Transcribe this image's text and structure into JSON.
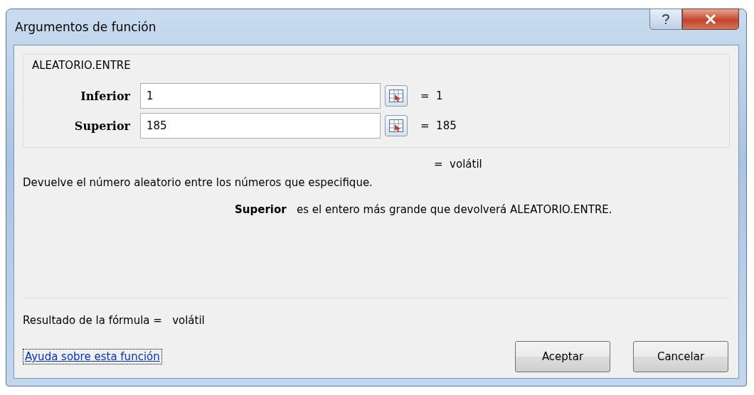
{
  "window": {
    "title": "Argumentos de función"
  },
  "function_name": "ALEATORIO.ENTRE",
  "arguments": [
    {
      "label": "Inferior",
      "value": "1",
      "result": "=  1"
    },
    {
      "label": "Superior",
      "value": "185",
      "result": "=  185"
    }
  ],
  "function_result": "=  volátil",
  "description": "Devuelve el número aleatorio entre los números que especifique.",
  "argument_help": {
    "label": "Superior",
    "text": "es el entero más grande que devolverá ALEATORIO.ENTRE."
  },
  "formula_result": "Resultado de la fórmula =   volátil",
  "help_link": "Ayuda sobre esta función",
  "buttons": [
    "Aceptar",
    "Cancelar"
  ]
}
